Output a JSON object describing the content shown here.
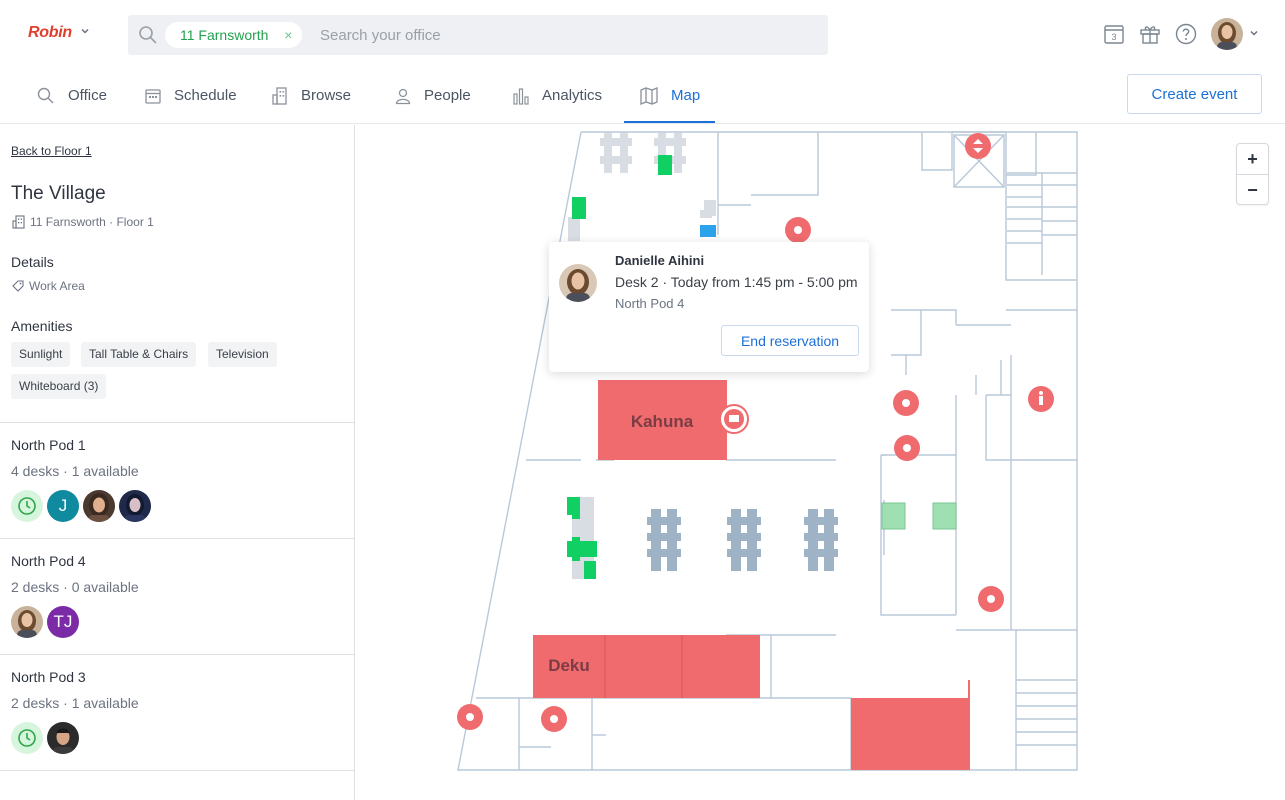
{
  "app": {
    "logo": "Robin"
  },
  "search": {
    "chip_label": "11 Farnsworth",
    "chip_close": "×",
    "placeholder": "Search your office"
  },
  "header": {
    "calendar_day": "3"
  },
  "nav": {
    "items": [
      {
        "label": "Office"
      },
      {
        "label": "Schedule"
      },
      {
        "label": "Browse"
      },
      {
        "label": "People"
      },
      {
        "label": "Analytics"
      },
      {
        "label": "Map"
      }
    ],
    "active": "Map",
    "create_label": "Create event"
  },
  "sidebar": {
    "back_label": "Back to Floor 1",
    "space_title": "The Village",
    "space_location": "11 Farnsworth · Floor 1",
    "details_heading": "Details",
    "details_value": "Work Area",
    "amenities_heading": "Amenities",
    "amenities": [
      "Sunlight",
      "Tall Table & Chairs",
      "Television",
      "Whiteboard (3)"
    ],
    "pods": [
      {
        "title": "North Pod 1",
        "summary": "4 desks · 1 available",
        "avatar_initial": "J"
      },
      {
        "title": "North Pod 4",
        "summary": "2 desks · 0 available",
        "avatar_initial": "TJ"
      },
      {
        "title": "North Pod 3",
        "summary": "2 desks · 1 available"
      }
    ]
  },
  "map": {
    "rooms": [
      {
        "label": "Kahuna"
      },
      {
        "label": "Deku"
      }
    ],
    "zoom_in": "+",
    "zoom_out": "−",
    "colors": {
      "room_booked": "#ef6b6e",
      "desk_available": "#10d063",
      "desk_selected": "#2ba3ea",
      "desk_unavailable": "#9fb3c6",
      "desk_light": "#d7dde3",
      "pin": "#ef6b6e",
      "wall": "#b9c8d8"
    }
  },
  "popup": {
    "name": "Danielle Aihini",
    "desk": "Desk 2 · Today from 1:45 pm - 5:00 pm",
    "pod": "North Pod 4",
    "end_label": "End reservation"
  }
}
